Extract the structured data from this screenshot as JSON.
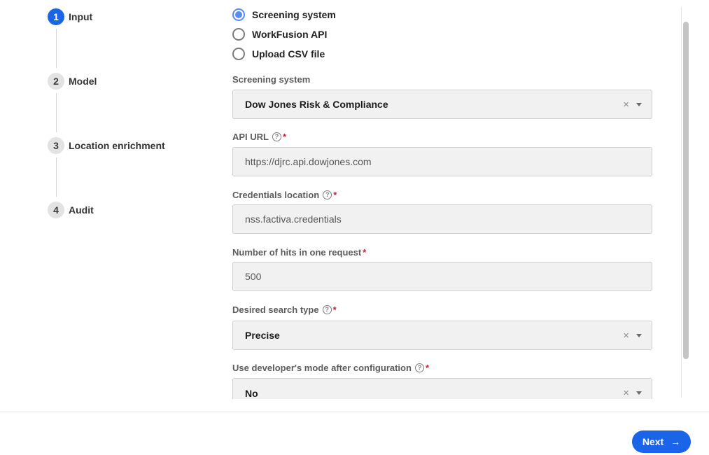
{
  "stepper": {
    "steps": [
      {
        "num": "1",
        "label": "Input"
      },
      {
        "num": "2",
        "label": "Model"
      },
      {
        "num": "3",
        "label": "Location enrichment"
      },
      {
        "num": "4",
        "label": "Audit"
      }
    ]
  },
  "source": {
    "options": [
      "Screening system",
      "WorkFusion API",
      "Upload CSV file"
    ],
    "selected": "Screening system"
  },
  "fields": {
    "screening_system": {
      "label": "Screening system",
      "value": "Dow Jones Risk & Compliance"
    },
    "api_url": {
      "label": "API URL",
      "value": "https://djrc.api.dowjones.com"
    },
    "credentials": {
      "label": "Credentials location",
      "value": "nss.factiva.credentials"
    },
    "hits": {
      "label": "Number of hits in one request",
      "value": "500"
    },
    "search_type": {
      "label": "Desired search type",
      "value": "Precise"
    },
    "dev_mode": {
      "label": "Use developer's mode after configuration",
      "value": "No"
    }
  },
  "symbols": {
    "required": "*",
    "help": "?",
    "clear": "×",
    "arrow": "→"
  },
  "footer": {
    "next_label": "Next"
  },
  "colors": {
    "accent": "#1a64e8",
    "required": "#c81c3c",
    "radio_selected": "#5b8def"
  }
}
